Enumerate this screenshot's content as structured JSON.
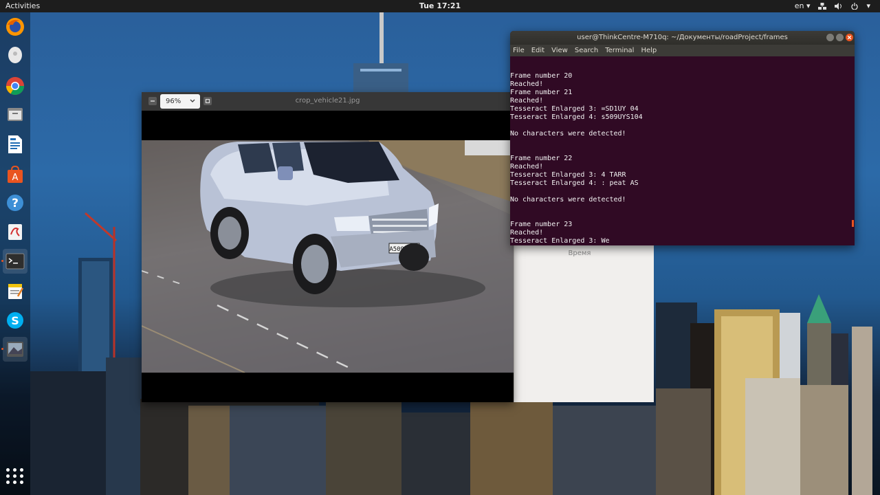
{
  "topbar": {
    "activities": "Activities",
    "clock": "Tue 17:21",
    "lang": "en",
    "lang_caret": "▾",
    "menu_caret": "▾"
  },
  "dock": {
    "items": [
      {
        "name": "firefox-icon"
      },
      {
        "name": "disk-icon"
      },
      {
        "name": "chrome-icon"
      },
      {
        "name": "files-icon"
      },
      {
        "name": "writer-icon"
      },
      {
        "name": "software-center-icon"
      },
      {
        "name": "help-icon"
      },
      {
        "name": "app-red-icon"
      },
      {
        "name": "terminal-icon"
      },
      {
        "name": "text-editor-icon"
      },
      {
        "name": "skype-icon"
      },
      {
        "name": "image-viewer-icon"
      }
    ]
  },
  "viewer": {
    "zoom": "96%",
    "title": "crop_vehicle21.jpg",
    "plate": "A509UY07"
  },
  "behind_window": {
    "label": "Время"
  },
  "terminal": {
    "title": "user@ThinkCentre-M710q: ~/Документы/roadProject/frames",
    "menu": [
      "File",
      "Edit",
      "View",
      "Search",
      "Terminal",
      "Help"
    ],
    "lines": [
      "Frame number 20",
      "Reached!",
      "Frame number 21",
      "Reached!",
      "Tesseract Enlarged 3: =SD1UY 04",
      "Tesseract Enlarged 4: s509UYS104",
      "",
      "No characters were detected!",
      "",
      "",
      "Frame number 22",
      "Reached!",
      "Tesseract Enlarged 3: 4 TARR",
      "Tesseract Enlarged 4: : peat AS",
      "",
      "No characters were detected!",
      "",
      "",
      "Frame number 23",
      "Reached!",
      "Tesseract Enlarged 3: We"
    ]
  },
  "colors": {
    "terminal_bg": "#300a24",
    "accent": "#e95420",
    "topbar_bg": "#1d1d1d"
  }
}
